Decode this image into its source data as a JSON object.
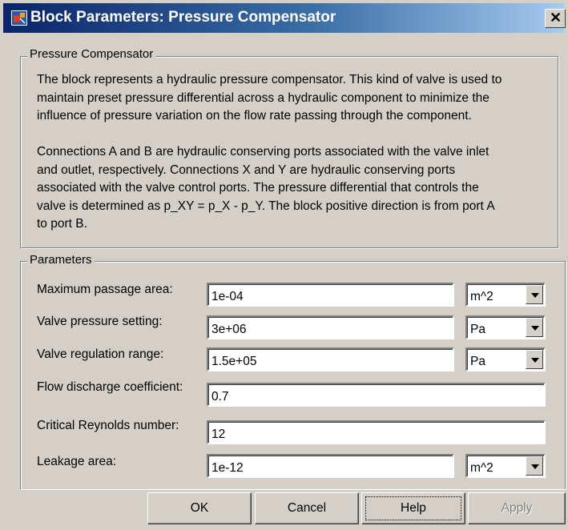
{
  "window": {
    "title": "Block Parameters: Pressure Compensator",
    "close_glyph": "✕"
  },
  "description_group": {
    "label": "Pressure Compensator",
    "paragraph1_lines": [
      "The block represents a hydraulic pressure compensator. This kind of valve is used to",
      "maintain preset pressure differential across a hydraulic component to minimize the",
      "influence of pressure variation on the flow rate passing through the component."
    ],
    "paragraph2_lines": [
      "Connections A and B are hydraulic conserving ports associated with the valve inlet",
      "and outlet, respectively. Connections X and Y are hydraulic conserving ports",
      "associated with the valve control ports. The pressure differential that controls the",
      "valve is determined as p_XY = p_X - p_Y. The block positive direction is from port A",
      "to port B."
    ]
  },
  "parameters_group": {
    "label": "Parameters",
    "rows": [
      {
        "label": "Maximum passage area:",
        "value": "1e-04",
        "unit": "m^2"
      },
      {
        "label": "Valve pressure setting:",
        "value": "3e+06",
        "unit": "Pa"
      },
      {
        "label": "Valve regulation range:",
        "value": "1.5e+05",
        "unit": "Pa"
      },
      {
        "label": "Flow discharge coefficient:",
        "value": "0.7"
      },
      {
        "label": "Critical Reynolds number:",
        "value": "12"
      },
      {
        "label": "Leakage area:",
        "value": "1e-12",
        "unit": "m^2"
      }
    ]
  },
  "buttons": {
    "ok": "OK",
    "cancel": "Cancel",
    "help": "Help",
    "apply": "Apply"
  },
  "icons": {
    "title_icon": "simulink-block-icon",
    "close_icon": "close-icon",
    "dropdown_icon": "chevron-down-icon"
  },
  "colors": {
    "title_bar_start": "#0a246a",
    "title_bar_end": "#a6caf0",
    "dialog_face": "#d4d0c8"
  }
}
